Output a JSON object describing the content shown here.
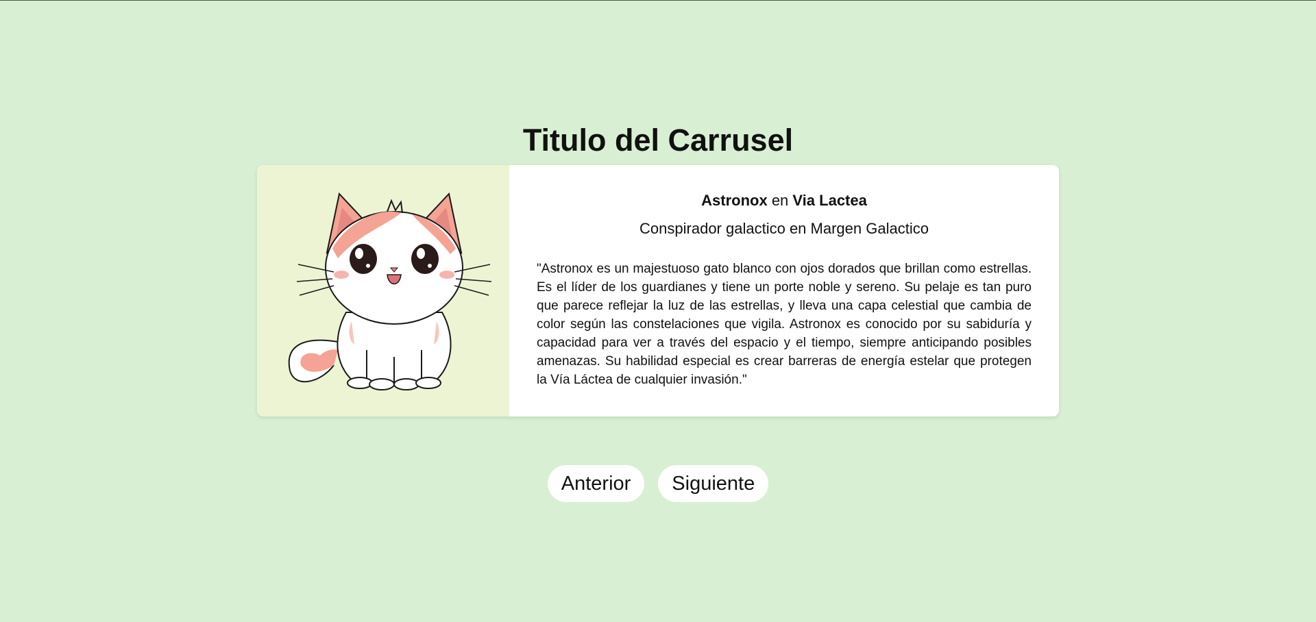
{
  "page": {
    "title": "Titulo del Carrusel"
  },
  "slide": {
    "name": "Astronox",
    "connector": " en ",
    "location": "Via Lactea",
    "subtitle": "Conspirador galactico en Margen Galactico",
    "description": "\"Astronox es un majestuoso gato blanco con ojos dorados que brillan como estrellas. Es el líder de los guardianes y tiene un porte noble y sereno. Su pelaje es tan puro que parece reflejar la luz de las estrellas, y lleva una capa celestial que cambia de color según las constelaciones que vigila. Astronox es conocido por su sabiduría y capacidad para ver a través del espacio y el tiempo, siempre anticipando posibles amenazas. Su habilidad especial es crear barreras de energía estelar que protegen la Vía Láctea de cualquier invasión.\"",
    "image_icon": "cat-illustration-icon"
  },
  "controls": {
    "prev_label": "Anterior",
    "next_label": "Siguiente"
  },
  "colors": {
    "background": "#d8efd3",
    "card": "#ffffff",
    "image_panel": "#ecf4d4",
    "cat_pink": "#f4a394"
  }
}
